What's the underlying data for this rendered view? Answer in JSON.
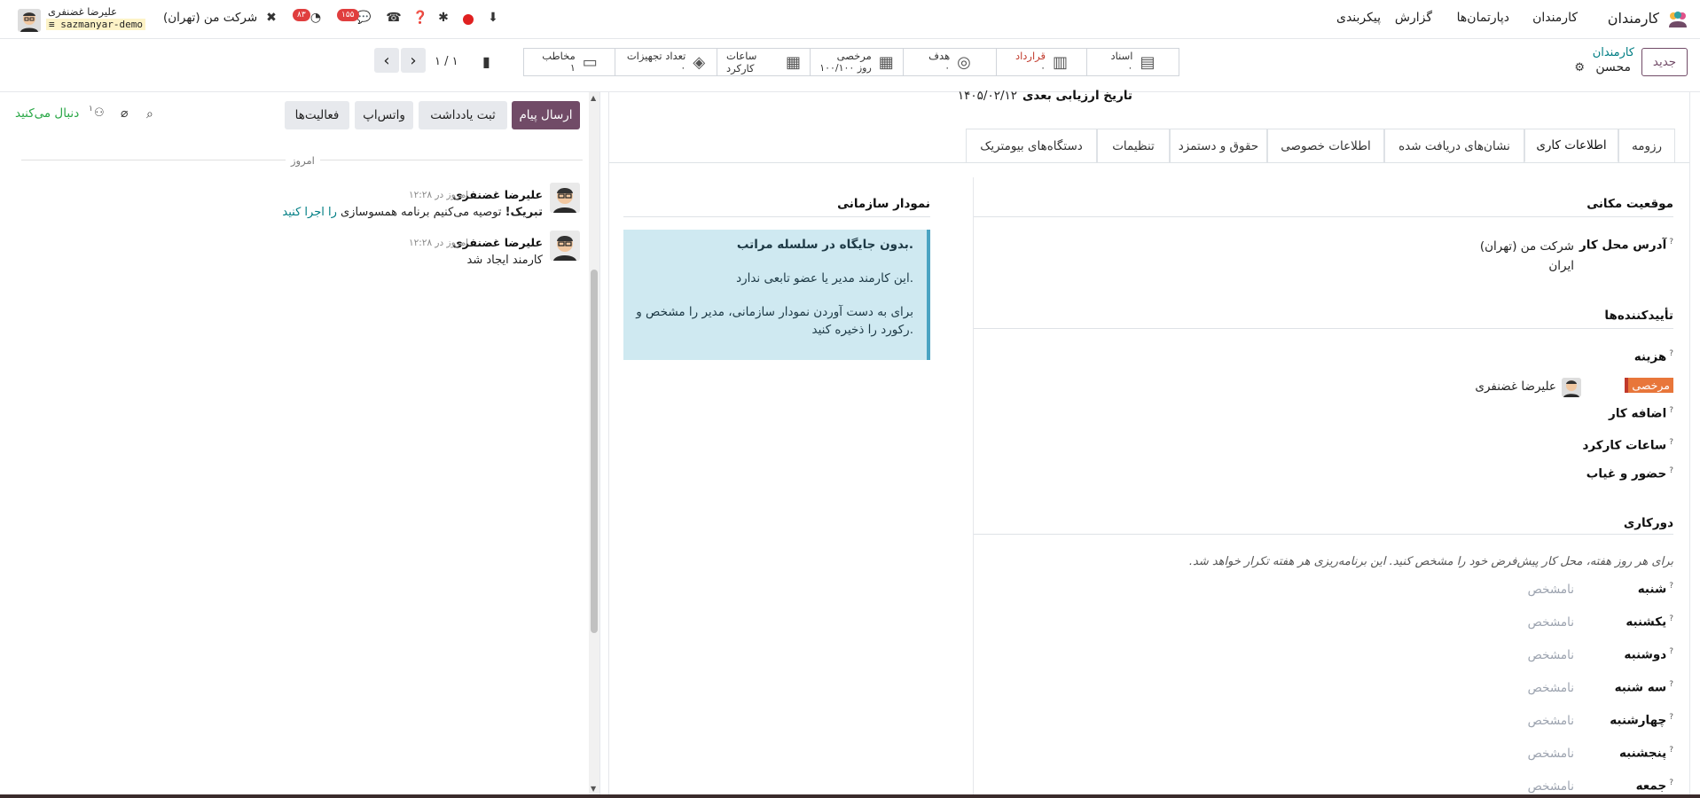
{
  "topbar": {
    "app_name": "کارمندان",
    "menu": [
      "کارمندان",
      "دپارتمان‌ها",
      "گزارش",
      "پیکربندی"
    ],
    "company": "شرکت من (تهران)",
    "user_name": "علیرضا غضنفری",
    "db_name": "sazmanyar-demo",
    "messages_badge": "۱۵۵",
    "activities_badge": "۸۳"
  },
  "control": {
    "new_button": "جدید",
    "breadcrumb_parent": "کارمندان",
    "breadcrumb_current": "محسن",
    "pager": "۱ / ۱"
  },
  "stats": [
    {
      "name": "stat-documents",
      "label": "اسناد",
      "value": "۰",
      "icon": "document-icon"
    },
    {
      "name": "stat-contracts",
      "label": "قرارداد",
      "value": "۰",
      "icon": "book-icon",
      "color": "#c0392b"
    },
    {
      "name": "stat-goals",
      "label": "هدف",
      "value": "۰",
      "icon": "target-icon"
    },
    {
      "name": "stat-timeoff",
      "label": "مرخصی",
      "value": "۱۰۰/۱۰۰ روز",
      "icon": "calendar-icon"
    },
    {
      "name": "stat-work-hours",
      "label": "ساعات کارکرد",
      "value": "",
      "icon": "calendar-icon"
    },
    {
      "name": "stat-equipment",
      "label": "تعداد تجهیزات",
      "value": "۰",
      "icon": "cubes-icon"
    },
    {
      "name": "stat-contacts",
      "label": "مخاطب",
      "value": "۱",
      "icon": "id-card-icon"
    }
  ],
  "form": {
    "next_review_label": "تاریخ ارزیابی بعدی",
    "next_review_value": "۱۴۰۵/۰۲/۱۲",
    "tabs": [
      "رزومه",
      "اطلاعات کاری",
      "نشان‌های دریافت شده",
      "اطلاعات خصوصی",
      "حقوق و دستمزد",
      "تنظیمات",
      "دستگاه‌های بیومتریک"
    ],
    "location": {
      "title": "موقعیت مکانی",
      "address_label": "آدرس محل کار",
      "address_line1": "شرکت من (تهران)",
      "address_line2": "ایران"
    },
    "approvers": {
      "title": "تأییدکننده‌ها",
      "expense_label": "هزینه",
      "timeoff_tag": "مرخصی",
      "timeoff_approver": "علیرضا غضنفری",
      "overtime_label": "اضافه کار",
      "timesheet_label": "ساعات کارکرد",
      "attendance_label": "حضور و غیاب"
    },
    "remote": {
      "title": "دورکاری",
      "hint": "برای هر روز هفته، محل کار پیش‌فرض خود را مشخص کنید. این برنامه‌ریزی هر هفته تکرار خواهد شد.",
      "days": [
        {
          "label": "شنبه",
          "value": "نامشخص"
        },
        {
          "label": "یکشنبه",
          "value": "نامشخص"
        },
        {
          "label": "دوشنبه",
          "value": "نامشخص"
        },
        {
          "label": "سه شنبه",
          "value": "نامشخص"
        },
        {
          "label": "چهارشنبه",
          "value": "نامشخص"
        },
        {
          "label": "پنجشنبه",
          "value": "نامشخص"
        },
        {
          "label": "جمعه",
          "value": "نامشخص"
        }
      ]
    },
    "org_chart": {
      "title": "نمودار سازمانی",
      "alert_title": "بدون جایگاه در سلسله مراتب.",
      "alert_line1": "این کارمند مدیر یا عضو تابعی ندارد.",
      "alert_line2a": "برای به دست آوردن نمودار سازمانی، مدیر را مشخص و",
      "alert_line2b": "رکورد را ذخیره کنید."
    }
  },
  "chatter": {
    "send_message": "ارسال پیام",
    "log_note": "ثبت یادداشت",
    "whatsapp": "واتس‌اپ",
    "activities": "فعالیت‌ها",
    "followers_count": "۱",
    "follow": "دنبال می‌کنید",
    "today": "امروز",
    "messages": [
      {
        "author": "علیرضا غضنفری",
        "time": "امروز در ۱۲:۲۸",
        "bold": "تبریک!",
        "text": " توصیه می‌کنیم برنامه همسوسازی ",
        "link": "را اجرا کنید"
      },
      {
        "author": "علیرضا غضنفری",
        "time": "امروز در ۱۲:۲۸",
        "text": "کارمند ایجاد شد"
      }
    ]
  },
  "colors": {
    "primary": "#714b67",
    "link": "#017e84",
    "alert_bg": "#cfe9f1",
    "tag_bg": "#e8763a"
  }
}
